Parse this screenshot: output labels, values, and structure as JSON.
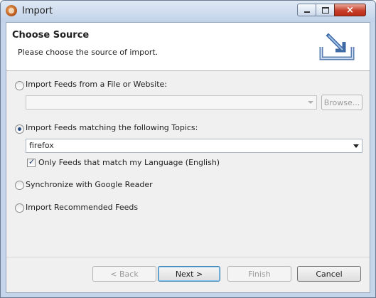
{
  "window": {
    "title": "Import",
    "close_glyph": "×"
  },
  "header": {
    "title": "Choose Source",
    "description": "Please choose the source of import.",
    "graphic_icon": "import-tray-icon"
  },
  "options": [
    {
      "label": "Import Feeds from a File or Website:",
      "selected": false
    },
    {
      "label": "Import Feeds matching the following Topics:",
      "selected": true
    },
    {
      "label": "Synchronize with Google Reader",
      "selected": false
    },
    {
      "label": "Import Recommended Feeds",
      "selected": false
    }
  ],
  "file_source": {
    "value": "",
    "browse_label": "Browse..."
  },
  "topics": {
    "value": "firefox",
    "language_filter_label": "Only Feeds that match my Language (English)",
    "language_filter_checked": true,
    "checkmark": "✓"
  },
  "buttons": {
    "back": "< Back",
    "next": "Next >",
    "finish": "Finish",
    "cancel": "Cancel"
  },
  "colors": {
    "title_bar": "#c4d5ea",
    "close_button": "#c8402b",
    "dialog_background": "#f0f0f0"
  }
}
